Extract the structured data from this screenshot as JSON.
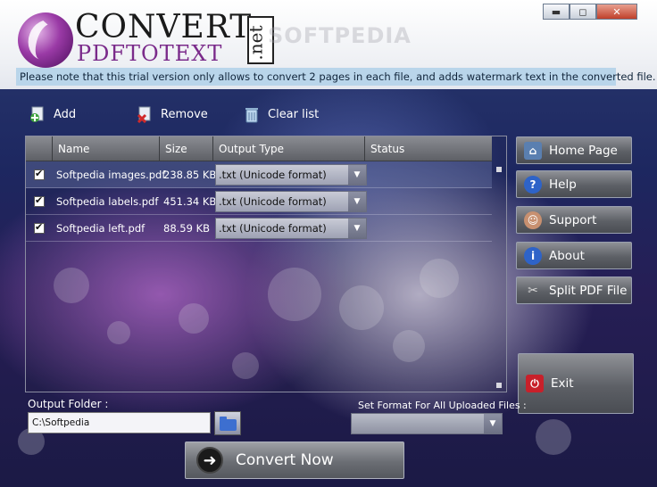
{
  "header": {
    "logo_convert": "CONVERT",
    "logo_pdftotext": "PDFTOTEXT",
    "logo_net": ".net",
    "watermark": "SOFTPEDIA",
    "notice": "Please note that this trial version only allows to convert 2 pages in each file, and adds watermark text in the converted file."
  },
  "window_controls": {
    "minimize": "▬",
    "maximize": "◻",
    "close": "✕"
  },
  "toolbar": {
    "add": "Add",
    "remove": "Remove",
    "clear": "Clear list"
  },
  "grid": {
    "columns": [
      "Name",
      "Size",
      "Output Type",
      "Status"
    ],
    "rows": [
      {
        "name": "Softpedia images.pdf",
        "size": "238.85 KB",
        "output": ".txt (Unicode format)",
        "status": ""
      },
      {
        "name": "Softpedia labels.pdf",
        "size": "451.34 KB",
        "output": ".txt (Unicode format)",
        "status": ""
      },
      {
        "name": "Softpedia left.pdf",
        "size": "88.59 KB",
        "output": ".txt (Unicode format)",
        "status": ""
      }
    ]
  },
  "side": {
    "home": "Home Page",
    "help": "Help",
    "support": "Support",
    "about": "About",
    "split": "Split PDF File",
    "exit": "Exit"
  },
  "bottom": {
    "output_label": "Output Folder :",
    "output_value": "C:\\Softpedia",
    "format_label": "Set Format For All Uploaded Files :",
    "format_value": "",
    "convert": "Convert Now"
  },
  "colors": {
    "accent_purple": "#7a2a8a",
    "notice_bg": "#b9d5ea",
    "exit_red": "#c8202a"
  }
}
